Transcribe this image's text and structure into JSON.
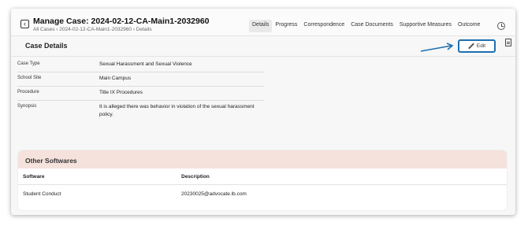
{
  "header": {
    "title": "Manage Case: 2024-02-12-CA-Main1-2032960",
    "breadcrumb": "All Cases › 2024-02-12-CA-Main1-2032960 › Details",
    "tabs": [
      {
        "label": "Details",
        "active": true
      },
      {
        "label": "Progress",
        "active": false
      },
      {
        "label": "Correspondence",
        "active": false
      },
      {
        "label": "Case Documents",
        "active": false
      },
      {
        "label": "Supportive Measures",
        "active": false
      },
      {
        "label": "Outcome",
        "active": false
      }
    ]
  },
  "section": {
    "title": "Case Details",
    "edit_label": "Edit"
  },
  "details": [
    {
      "label": "Case Type",
      "value": "Sexual Harassment and Sexual Violence"
    },
    {
      "label": "School Site",
      "value": "Main Campus"
    },
    {
      "label": "Procedure",
      "value": "Title IX Procedures"
    },
    {
      "label": "Synopsis",
      "value": "It is alleged there was behavior in violation of the sexual harassment policy."
    }
  ],
  "other_softwares": {
    "title": "Other Softwares",
    "columns": [
      "Software",
      "Description"
    ],
    "rows": [
      {
        "software": "Student Conduct",
        "description": "20230025@advocate.lb.com"
      }
    ]
  },
  "colors": {
    "accent": "#1e6fb0",
    "other_header_bg": "#f5e2dc"
  }
}
